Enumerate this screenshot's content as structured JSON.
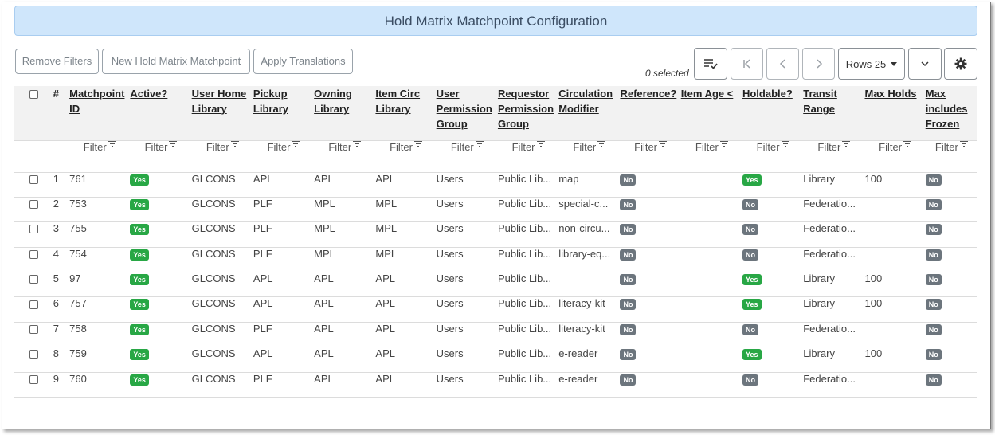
{
  "title": "Hold Matrix Matchpoint Configuration",
  "toolbar": {
    "remove_filters": "Remove Filters",
    "new_matchpoint": "New Hold Matrix Matchpoint",
    "apply_translations": "Apply Translations",
    "selected_count": "0 selected",
    "rows_label": "Rows 25"
  },
  "columns": [
    "#",
    "Matchpoint ID",
    "Active?",
    "User Home Library",
    "Pickup Library",
    "Owning Library",
    "Item Circ Library",
    "User Permission Group",
    "Requestor Permission Group",
    "Circulation Modifier",
    "Reference?",
    "Item Age <",
    "Holdable?",
    "Transit Range",
    "Max Holds",
    "Max includes Frozen"
  ],
  "filter_label": "Filter",
  "rows": [
    {
      "n": "1",
      "id": "761",
      "active": "Yes",
      "home": "GLCONS",
      "pickup": "APL",
      "owning": "APL",
      "circ": "APL",
      "perm": "Users",
      "req": "Public Lib...",
      "mod": "map",
      "ref": "No",
      "age": "",
      "holdable": "Yes",
      "transit": "Library",
      "max": "100",
      "frozen": "No"
    },
    {
      "n": "2",
      "id": "753",
      "active": "Yes",
      "home": "GLCONS",
      "pickup": "PLF",
      "owning": "MPL",
      "circ": "MPL",
      "perm": "Users",
      "req": "Public Lib...",
      "mod": "special-c...",
      "ref": "No",
      "age": "",
      "holdable": "No",
      "transit": "Federatio...",
      "max": "",
      "frozen": "No"
    },
    {
      "n": "3",
      "id": "755",
      "active": "Yes",
      "home": "GLCONS",
      "pickup": "PLF",
      "owning": "MPL",
      "circ": "MPL",
      "perm": "Users",
      "req": "Public Lib...",
      "mod": "non-circu...",
      "ref": "No",
      "age": "",
      "holdable": "No",
      "transit": "Federatio...",
      "max": "",
      "frozen": "No"
    },
    {
      "n": "4",
      "id": "754",
      "active": "Yes",
      "home": "GLCONS",
      "pickup": "PLF",
      "owning": "MPL",
      "circ": "MPL",
      "perm": "Users",
      "req": "Public Lib...",
      "mod": "library-eq...",
      "ref": "No",
      "age": "",
      "holdable": "No",
      "transit": "Federatio...",
      "max": "",
      "frozen": "No"
    },
    {
      "n": "5",
      "id": "97",
      "active": "Yes",
      "home": "GLCONS",
      "pickup": "APL",
      "owning": "APL",
      "circ": "APL",
      "perm": "Users",
      "req": "Public Lib...",
      "mod": "",
      "ref": "No",
      "age": "",
      "holdable": "Yes",
      "transit": "Library",
      "max": "100",
      "frozen": "No"
    },
    {
      "n": "6",
      "id": "757",
      "active": "Yes",
      "home": "GLCONS",
      "pickup": "APL",
      "owning": "APL",
      "circ": "APL",
      "perm": "Users",
      "req": "Public Lib...",
      "mod": "literacy-kit",
      "ref": "No",
      "age": "",
      "holdable": "Yes",
      "transit": "Library",
      "max": "100",
      "frozen": "No"
    },
    {
      "n": "7",
      "id": "758",
      "active": "Yes",
      "home": "GLCONS",
      "pickup": "PLF",
      "owning": "APL",
      "circ": "APL",
      "perm": "Users",
      "req": "Public Lib...",
      "mod": "literacy-kit",
      "ref": "No",
      "age": "",
      "holdable": "No",
      "transit": "Federatio...",
      "max": "",
      "frozen": "No"
    },
    {
      "n": "8",
      "id": "759",
      "active": "Yes",
      "home": "GLCONS",
      "pickup": "APL",
      "owning": "APL",
      "circ": "APL",
      "perm": "Users",
      "req": "Public Lib...",
      "mod": "e-reader",
      "ref": "No",
      "age": "",
      "holdable": "Yes",
      "transit": "Library",
      "max": "100",
      "frozen": "No"
    },
    {
      "n": "9",
      "id": "760",
      "active": "Yes",
      "home": "GLCONS",
      "pickup": "PLF",
      "owning": "APL",
      "circ": "APL",
      "perm": "Users",
      "req": "Public Lib...",
      "mod": "e-reader",
      "ref": "No",
      "age": "",
      "holdable": "No",
      "transit": "Federatio...",
      "max": "",
      "frozen": "No"
    }
  ],
  "colors": {
    "yes": "#28a745",
    "no": "#6c757d",
    "title_bg": "#cfe6fb"
  }
}
